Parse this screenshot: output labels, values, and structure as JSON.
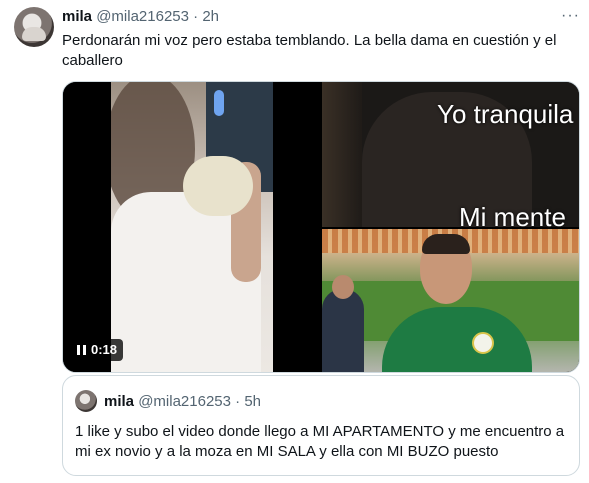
{
  "tweet": {
    "author_name": "mila",
    "author_handle": "@mila216253",
    "separator": "·",
    "time": "2h",
    "more_icon": "ellipsis-icon",
    "more_label": "···",
    "text": "Perdonarán mi voz pero estaba temblando. La bella dama en cuestión y el caballero"
  },
  "media": {
    "video": {
      "duration": "0:18",
      "control_icon": "pause-icon"
    },
    "meme": {
      "top_text": "Yo tranquila",
      "bottom_text": "Mi mente"
    },
    "photo": {
      "description_icon": "photo-icon"
    }
  },
  "quote": {
    "author_name": "mila",
    "author_handle": "@mila216253",
    "separator": "·",
    "time": "5h",
    "text": "1 like y subo el video donde llego a MI APARTAMENTO y me encuentro a mi ex novio y a la moza en MI SALA y ella con MI BUZO puesto"
  }
}
